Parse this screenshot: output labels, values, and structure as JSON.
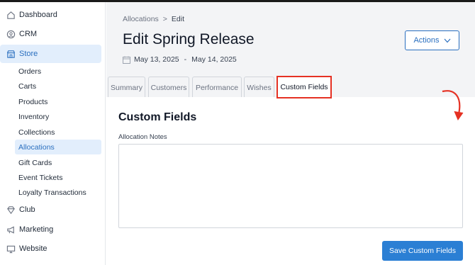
{
  "sidebar": {
    "top_items": [
      {
        "label": "Dashboard",
        "icon": "home-icon"
      },
      {
        "label": "CRM",
        "icon": "crm-icon"
      },
      {
        "label": "Store",
        "icon": "store-icon"
      },
      {
        "label": "Club",
        "icon": "diamond-icon"
      },
      {
        "label": "Marketing",
        "icon": "megaphone-icon"
      },
      {
        "label": "Website",
        "icon": "monitor-icon"
      }
    ],
    "store_items": [
      {
        "label": "Orders"
      },
      {
        "label": "Carts"
      },
      {
        "label": "Products"
      },
      {
        "label": "Inventory"
      },
      {
        "label": "Collections"
      },
      {
        "label": "Allocations"
      },
      {
        "label": "Gift Cards"
      },
      {
        "label": "Event Tickets"
      },
      {
        "label": "Loyalty Transactions"
      }
    ]
  },
  "breadcrumb": {
    "parent": "Allocations",
    "separator": ">",
    "current": "Edit"
  },
  "page": {
    "title": "Edit Spring Release",
    "start_date": "May 13, 2025",
    "date_separator": "-",
    "end_date": "May 14, 2025",
    "actions_label": "Actions"
  },
  "tabs": [
    {
      "label": "Summary"
    },
    {
      "label": "Customers"
    },
    {
      "label": "Performance"
    },
    {
      "label": "Wishes"
    },
    {
      "label": "Custom Fields"
    }
  ],
  "custom_fields": {
    "section_title": "Custom Fields",
    "notes_label": "Allocation Notes",
    "notes_value": "",
    "save_label": "Save Custom Fields"
  },
  "colors": {
    "accent": "#2b7fd4",
    "highlight": "#e53123",
    "active_bg": "#e2eefc"
  }
}
